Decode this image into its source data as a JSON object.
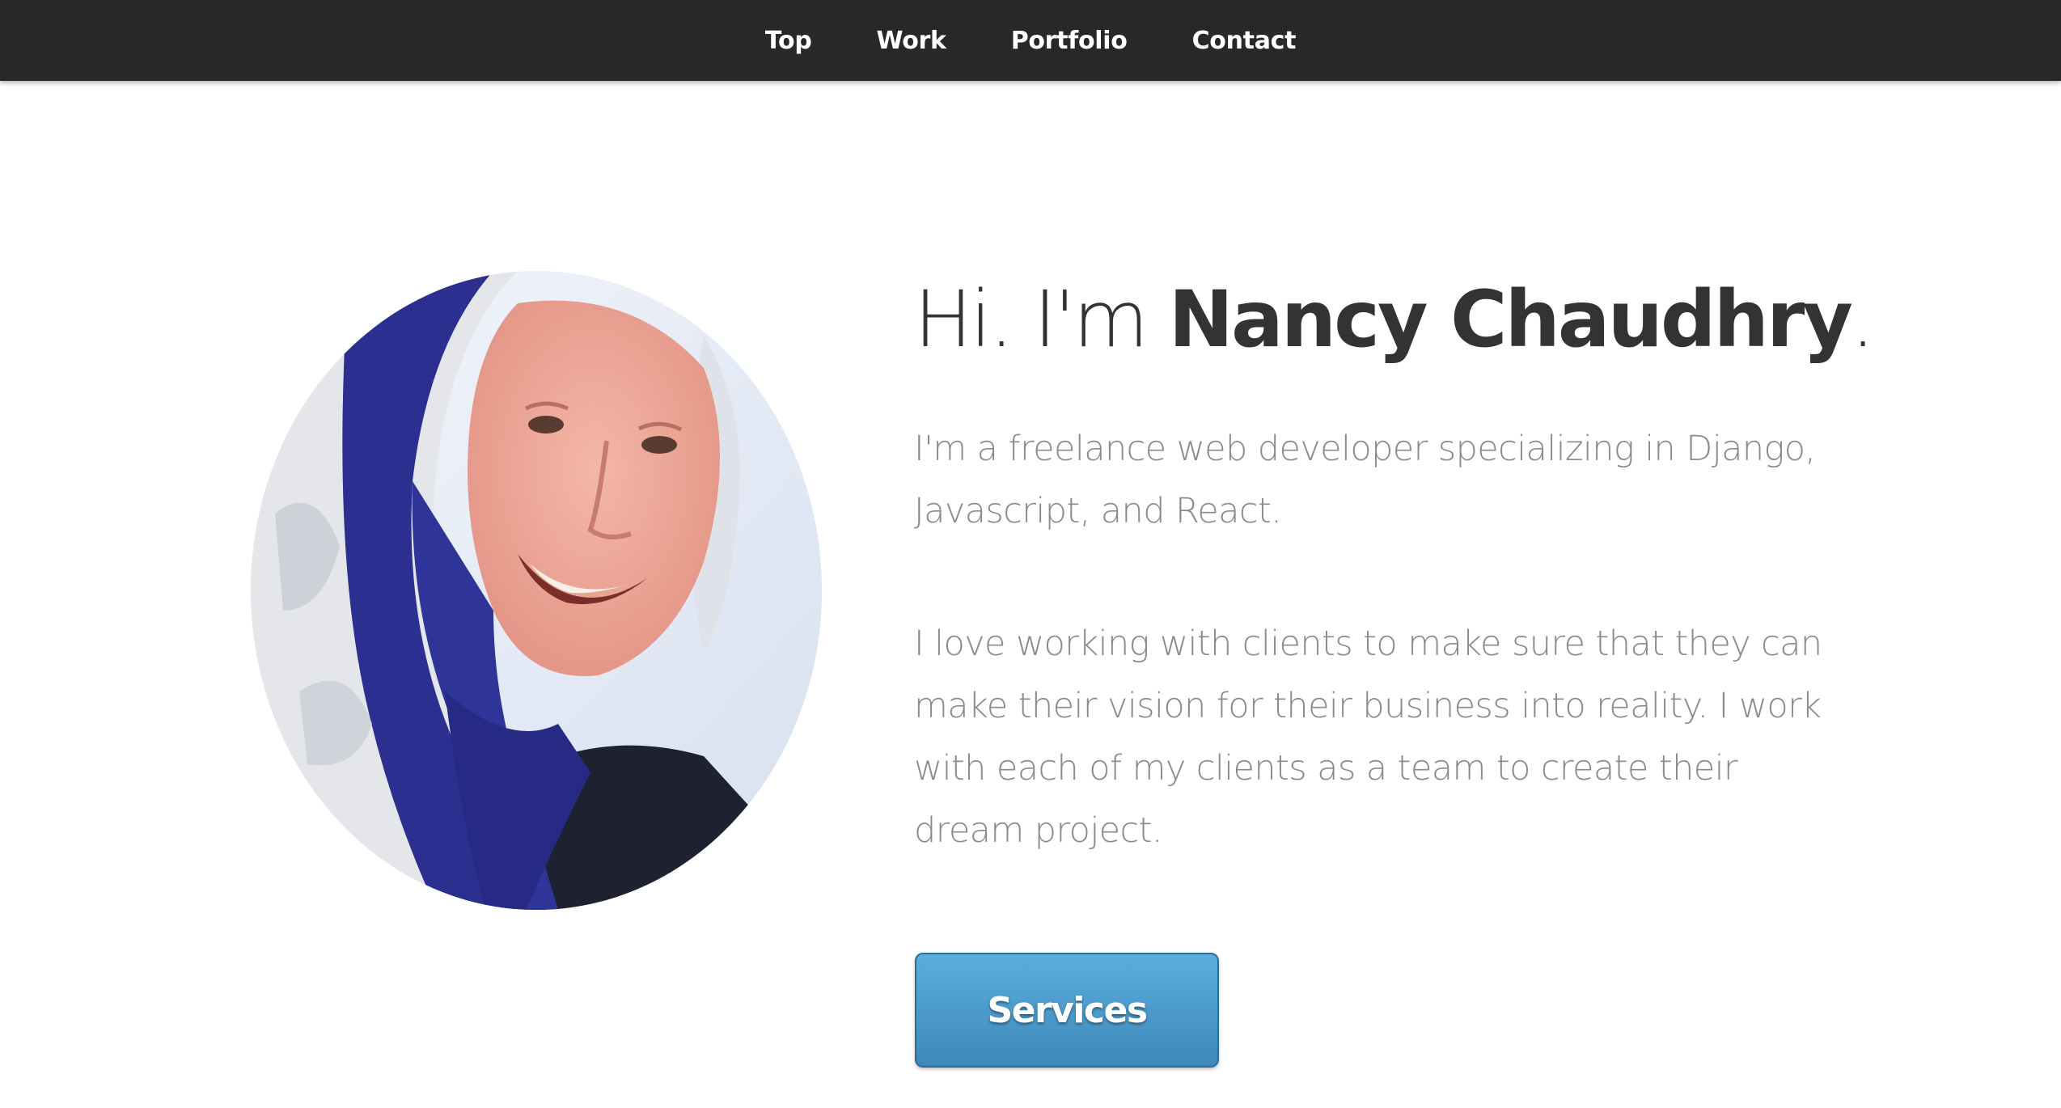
{
  "nav": {
    "items": [
      {
        "label": "Top"
      },
      {
        "label": "Work"
      },
      {
        "label": "Portfolio"
      },
      {
        "label": "Contact"
      }
    ]
  },
  "hero": {
    "greeting": "Hi. I'm ",
    "name": "Nancy Chaudhry",
    "punctuation": ".",
    "paragraph1": "I'm a freelance web developer specializing in Django, Javascript, and React.",
    "paragraph2": "I love working with clients to make sure that they can make their vision for their business into reality. I work with each of my clients as a team to create their dream project.",
    "button_label": "Services"
  },
  "colors": {
    "navbar": "#282828",
    "heading": "#333333",
    "body_text": "#8a8a8a",
    "button": "#4b98c8"
  }
}
